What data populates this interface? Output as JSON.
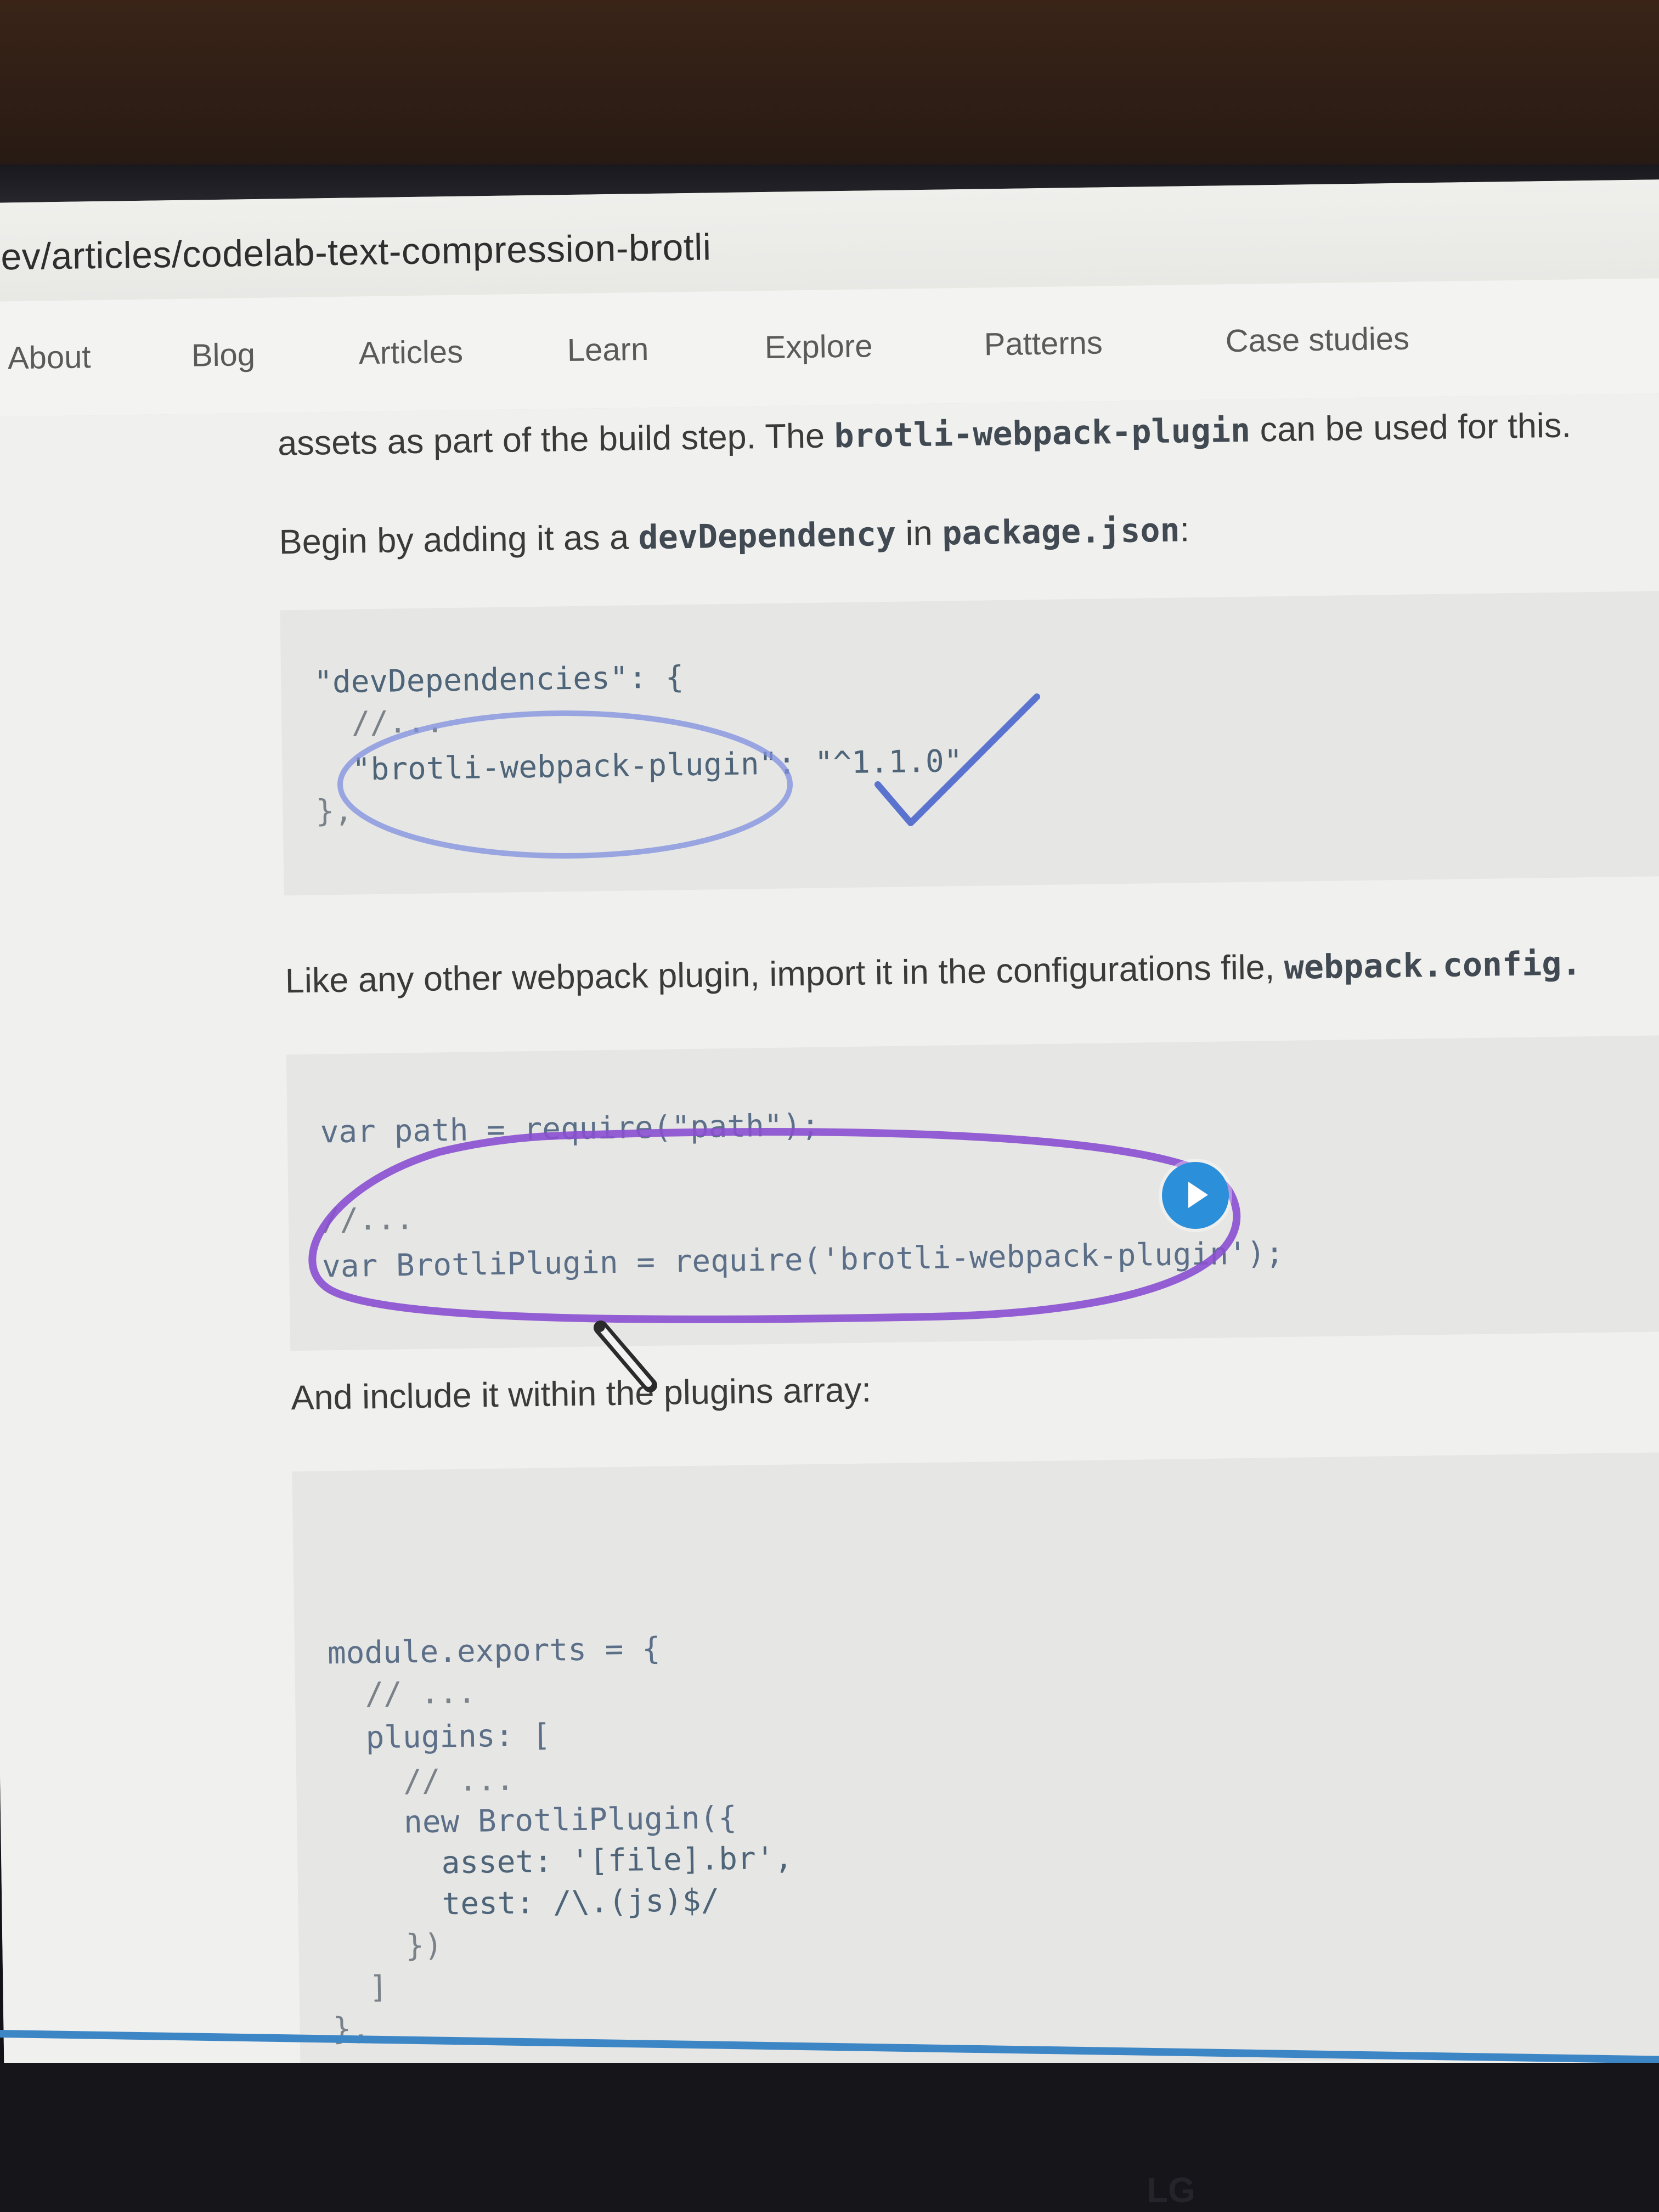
{
  "browser": {
    "url_fragment": "ev/articles/codelab-text-compression-brotli"
  },
  "nav": {
    "items": [
      "About",
      "Blog",
      "Articles",
      "Learn",
      "Explore",
      "Patterns",
      "Case studies"
    ]
  },
  "article": {
    "para1_text": "assets as part of the build step. The ",
    "para1_code": "brotli-webpack-plugin",
    "para1_tail": " can be used for this.",
    "para2_text": "Begin by adding it as a ",
    "para2_code1": "devDependency",
    "para2_mid": " in ",
    "para2_code2": "package.json",
    "para2_tail": ":",
    "code1": {
      "line1": "\"devDependencies\": {",
      "line2": "  //...",
      "line3": "  \"brotli-webpack-plugin\": \"^1.1.0\"",
      "line4": "},"
    },
    "para3_text": "Like any other webpack plugin, import it in the configurations file, ",
    "para3_code": "webpack.config.",
    "code2": {
      "line1": "var path = require(\"path\");",
      "line2": "//...",
      "line3": "var BrotliPlugin = require('brotli-webpack-plugin');"
    },
    "para4_text": "And include it within the plugins array:",
    "code3": {
      "line1": "module.exports = {",
      "line2": "  // ...",
      "line3": "  plugins: [",
      "line4": "    // ...",
      "line5": "    new BrotliPlugin({",
      "line6": "      asset: '[file].br',",
      "line7": "      test: /\\.(js)$/",
      "line8": "    })",
      "line9": "  ]",
      "line10": "},"
    }
  },
  "monitor": {
    "brand": "LG"
  },
  "colors": {
    "annotation_blue": "#7d8fe0",
    "annotation_purple": "#8a4fd0",
    "play_button": "#2c8fd9",
    "screen_edge": "#3d86c6"
  }
}
